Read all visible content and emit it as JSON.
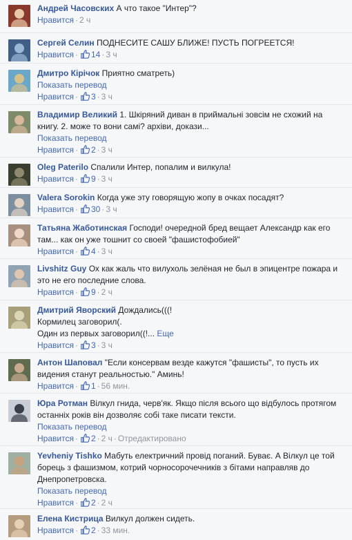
{
  "labels": {
    "like": "Нравится",
    "translate": "Показать перевод",
    "edited": "Отредактировано",
    "more": "Еще",
    "dot": "·"
  },
  "comments": [
    {
      "name": "Андрей Часовских",
      "lines": [
        "А что такое \"Интер\"?"
      ],
      "likes": "",
      "time": "2 ч",
      "translate": false,
      "avatar": {
        "bg": "#8a3a2c",
        "fg": "#e9c7a6"
      }
    },
    {
      "name": "Сергей Селин",
      "lines": [
        "ПОДНЕСИТЕ САШУ БЛИЖЕ! ПУСТЬ ПОГРЕЕТСЯ!"
      ],
      "likes": "14",
      "time": "3 ч",
      "translate": false,
      "avatar": {
        "bg": "#3f5f86",
        "fg": "#9ab7d6"
      }
    },
    {
      "name": "Дмитро Кірічок",
      "lines": [
        "Приятно сматреть)"
      ],
      "likes": "3",
      "time": "3 ч",
      "translate": true,
      "avatar": {
        "bg": "#6aa7c9",
        "fg": "#d6c08a"
      }
    },
    {
      "name": "Владимир Великий",
      "lines": [
        "1. Шкіряний диван в приймальні зовсім не схожий на",
        "книгу. 2. може то вони самі? архіви, докази..."
      ],
      "likes": "2",
      "time": "3 ч",
      "translate": true,
      "avatar": {
        "bg": "#7d8b6a",
        "fg": "#d8b79a"
      }
    },
    {
      "name": "Oleg Paterilo",
      "lines": [
        "Спалили Интер, попалим и вилкула!"
      ],
      "likes": "9",
      "time": "3 ч",
      "translate": false,
      "avatar": {
        "bg": "#3b3f2f",
        "fg": "#8f8a6e"
      }
    },
    {
      "name": "Valera Sorokin",
      "lines": [
        "Когда уже эту говорящую жопу в очках посадят?"
      ],
      "likes": "30",
      "time": "3 ч",
      "translate": false,
      "avatar": {
        "bg": "#7b8fa1",
        "fg": "#e2d2c2"
      }
    },
    {
      "name": "Татьяна Жаботинская",
      "lines": [
        "Господи! очередной бред вещает Александр как его",
        "там... как он уже тошнит со своей \"фашистофобией\""
      ],
      "likes": "4",
      "time": "3 ч",
      "translate": false,
      "avatar": {
        "bg": "#a8907e",
        "fg": "#f0d7c5"
      }
    },
    {
      "name": "Livshitz Guy",
      "lines": [
        "Ох как жаль что вилухоль зелёная не был в эпицентре пожара и",
        "это не его последние слова."
      ],
      "likes": "9",
      "time": "2 ч",
      "translate": false,
      "avatar": {
        "bg": "#8fa3b3",
        "fg": "#e0c6ae"
      }
    },
    {
      "name": "Дмитрий Яворский",
      "lines": [
        "Дождались(((!",
        "Кормилец заговорил(.",
        "Один из первых заговорил((!..."
      ],
      "likes": "3",
      "time": "3 ч",
      "translate": false,
      "more": true,
      "avatar": {
        "bg": "#a7a07a",
        "fg": "#dcd6b6"
      }
    },
    {
      "name": "Антон Шаповал",
      "lines": [
        "\"Если консервам везде кажутся \"фашисты\", то пусть их",
        "видения станут реальностью.\" Аминь!"
      ],
      "likes": "1",
      "time": "56 мин.",
      "translate": false,
      "avatar": {
        "bg": "#5e6b4e",
        "fg": "#c9a98f"
      }
    },
    {
      "name": "Юра Ротман",
      "lines": [
        "Вілкул гнида, черв'як. Якщо після всього що відбулось протягом",
        "останніх років він дозволяє собі таке писати тексти."
      ],
      "likes": "2",
      "time": "2 ч",
      "translate": true,
      "edited": true,
      "avatar": {
        "bg": "#c9ced6",
        "fg": "#3a3f4a"
      }
    },
    {
      "name": "Yevheniy Tishko",
      "lines": [
        "Мабуть електричний провід поганий. Буває. А Вілкул це той",
        "борець з фашизмом, котрий чорносорочечників з бітами направляв до",
        "Днепропетровска."
      ],
      "likes": "",
      "time": "",
      "translate": true,
      "actions": false,
      "avatar": {
        "bg": "#9fb0a3",
        "fg": "#c7a27e"
      }
    },
    {
      "name": "Елена Кистрица",
      "lines": [
        "Вилкул должен сидеть."
      ],
      "likes": "2",
      "time": "33 мин.",
      "translate": false,
      "avatar": {
        "bg": "#b59c7f",
        "fg": "#e6d0b5"
      }
    }
  ],
  "extra": {
    "tishko_actions": {
      "likes": "2",
      "time": "2 ч"
    }
  }
}
